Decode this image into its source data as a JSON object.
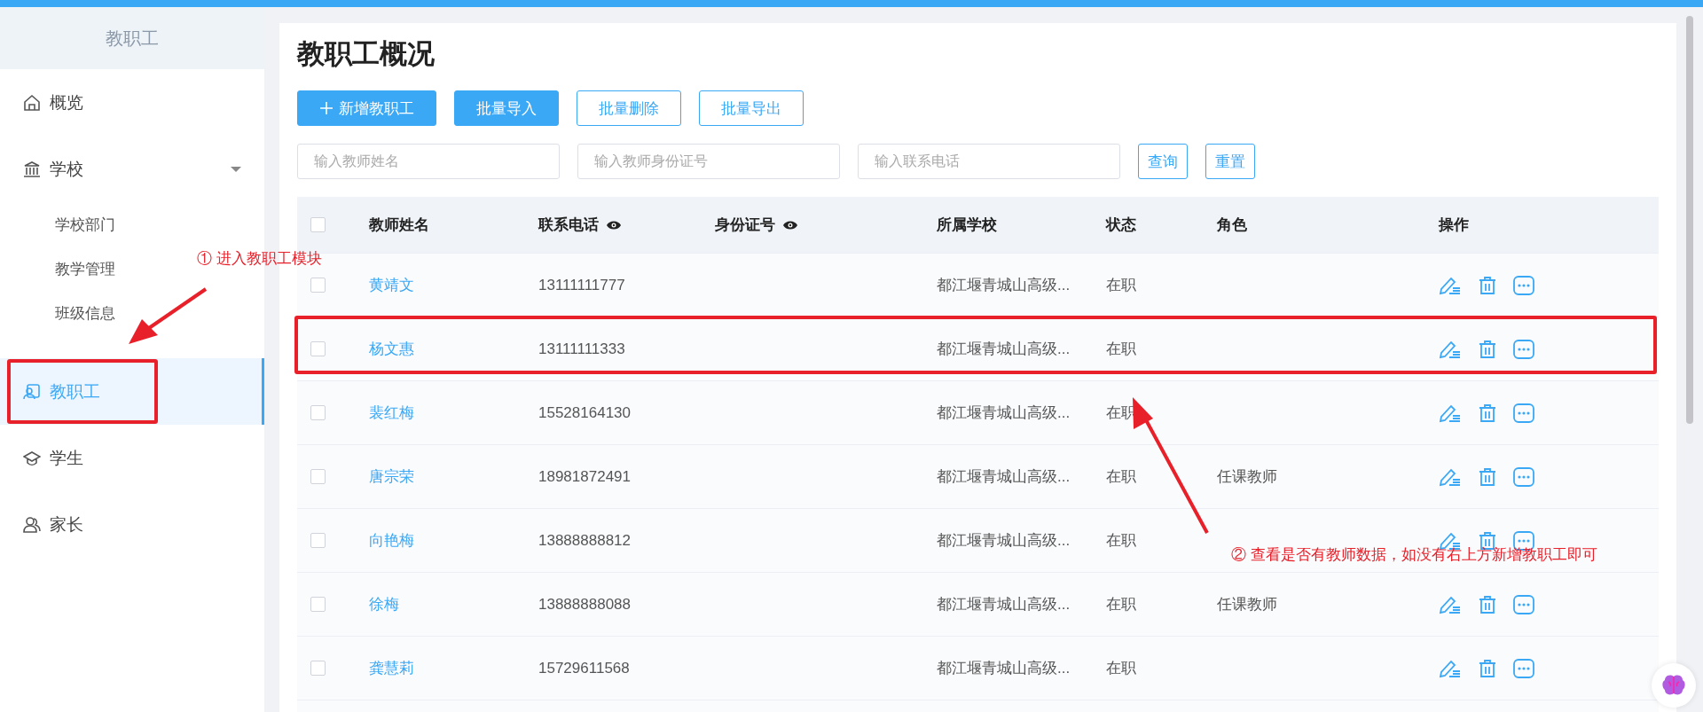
{
  "sidebar": {
    "title": "教职工",
    "items": [
      {
        "kind": "item",
        "label": "概览",
        "selected": false
      },
      {
        "kind": "group",
        "label": "学校",
        "selected": false,
        "expanded": true,
        "children": [
          {
            "kind": "sub",
            "label": "学校部门",
            "selected": false
          },
          {
            "kind": "sub",
            "label": "教学管理",
            "selected": false
          },
          {
            "kind": "sub",
            "label": "班级信息",
            "selected": false
          }
        ]
      },
      {
        "kind": "item",
        "label": "教职工",
        "selected": true
      },
      {
        "kind": "item",
        "label": "学生",
        "selected": false
      },
      {
        "kind": "item",
        "label": "家长",
        "selected": false
      }
    ]
  },
  "page": {
    "title": "教职工概况",
    "buttons": [
      {
        "label": "新增教职工",
        "kind": "primary",
        "plus": true
      },
      {
        "label": "批量导入",
        "kind": "primary",
        "plus": false
      },
      {
        "label": "批量删除",
        "kind": "outline",
        "plus": false
      },
      {
        "label": "批量导出",
        "kind": "outline",
        "plus": false
      }
    ],
    "filters": [
      {
        "placeholder": "输入教师姓名"
      },
      {
        "placeholder": "输入教师身份证号"
      },
      {
        "placeholder": "输入联系电话"
      }
    ],
    "filter_buttons": [
      "查询",
      "重置"
    ],
    "table": {
      "select_all": {
        "checked": false
      },
      "columns": [
        {
          "label": "教师姓名",
          "visibility_toggle": false
        },
        {
          "label": "联系电话",
          "visibility_toggle": true
        },
        {
          "label": "身份证号",
          "visibility_toggle": true
        },
        {
          "label": "所属学校",
          "visibility_toggle": false
        },
        {
          "label": "状态",
          "visibility_toggle": false
        },
        {
          "label": "角色",
          "visibility_toggle": false
        },
        {
          "label": "操作",
          "visibility_toggle": false
        }
      ],
      "rows": [
        {
          "checked": false,
          "name": "黄靖文",
          "phone": "13111111777",
          "school": "都江堰青城山高级...",
          "status": "在职"
        },
        {
          "checked": false,
          "name": "杨文惠",
          "phone": "13111111333",
          "school": "都江堰青城山高级...",
          "status": "在职"
        },
        {
          "checked": false,
          "name": "裴红梅",
          "phone": "15528164130",
          "school": "都江堰青城山高级...",
          "status": "在职"
        },
        {
          "checked": false,
          "name": "唐宗荣",
          "phone": "18981872491",
          "school": "都江堰青城山高级...",
          "status": "在职",
          "role": "任课教师"
        },
        {
          "checked": false,
          "name": "向艳梅",
          "phone": "13888888812",
          "school": "都江堰青城山高级...",
          "status": "在职"
        },
        {
          "checked": false,
          "name": "徐梅",
          "phone": "13888888088",
          "school": "都江堰青城山高级...",
          "status": "在职",
          "role": "任课教师"
        },
        {
          "checked": false,
          "name": "龚慧莉",
          "phone": "15729611568",
          "school": "都江堰青城山高级...",
          "status": "在职"
        }
      ]
    }
  },
  "annotations": [
    {
      "text": "① 进入教职工模块"
    },
    {
      "text": "② 查看是否有教师数据，如没有右上方新增教职工即可"
    }
  ]
}
